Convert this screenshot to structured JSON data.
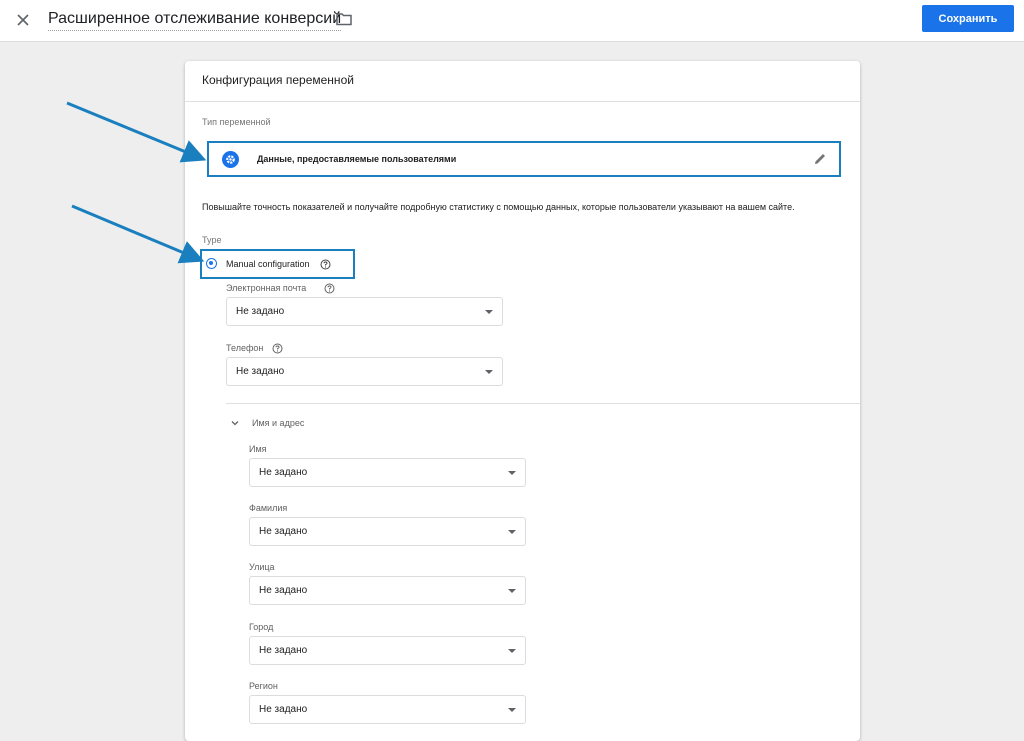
{
  "header": {
    "title": "Расширенное отслеживание конверсий",
    "save_label": "Сохранить",
    "close_icon": "close-icon",
    "folder_icon": "folder-icon"
  },
  "card": {
    "header_title": "Конфигурация переменной",
    "variable_type_label": "Тип переменной",
    "variable_type_value": "Данные, предоставляемые пользователями",
    "description": "Повышайте точность показателей и получайте подробную статистику с помощью данных, которые пользователи указывают на вашем сайте.",
    "type_label": "Type",
    "manual_config_label": "Manual configuration",
    "email": {
      "label": "Электронная почта",
      "value": "Не задано"
    },
    "phone": {
      "label": "Телефон",
      "value": "Не задано"
    },
    "name_address_section": "Имя и адрес",
    "first_name": {
      "label": "Имя",
      "value": "Не задано"
    },
    "last_name": {
      "label": "Фамилия",
      "value": "Не задано"
    },
    "street": {
      "label": "Улица",
      "value": "Не задано"
    },
    "city": {
      "label": "Город",
      "value": "Не задано"
    },
    "region": {
      "label": "Регион",
      "value": "Не задано"
    }
  },
  "colors": {
    "accent": "#1a73e8",
    "annotation": "#1a7fbe",
    "background": "#eeeeee"
  }
}
